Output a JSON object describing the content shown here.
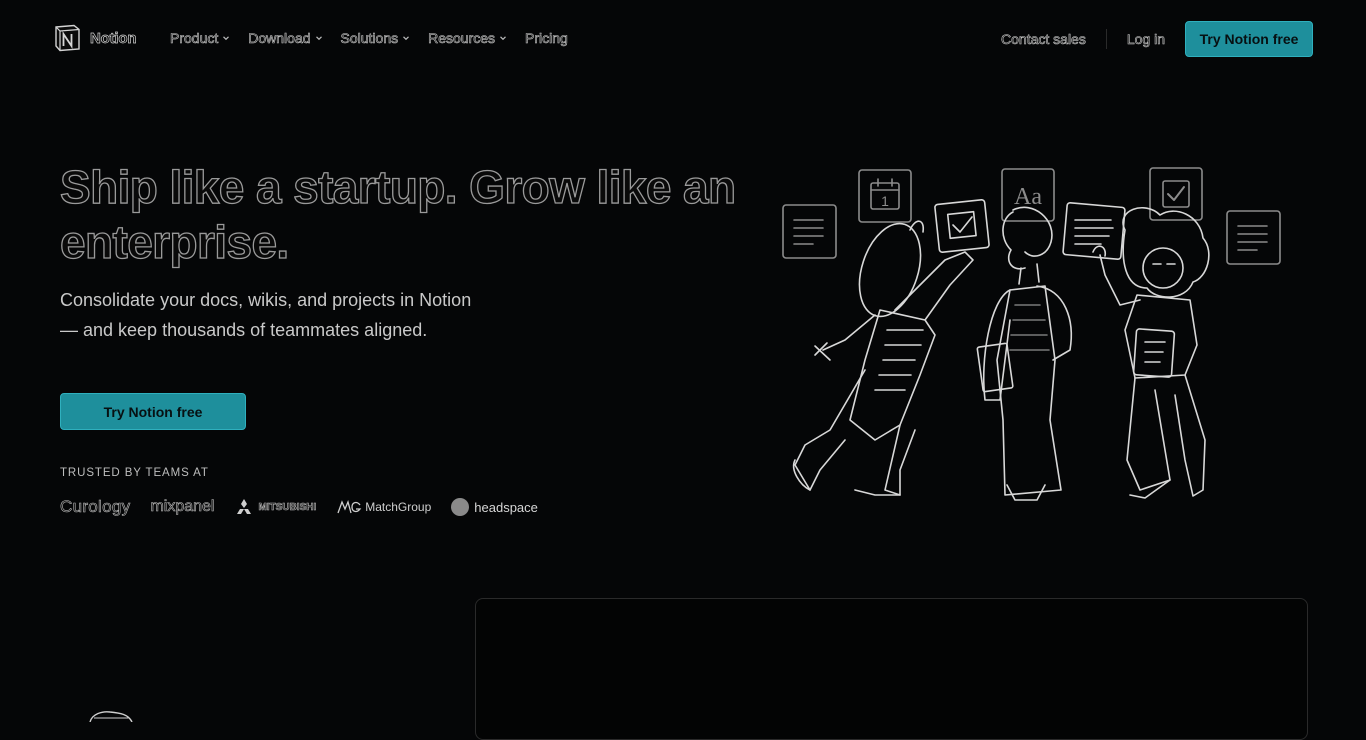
{
  "nav": {
    "logo_text": "Notion",
    "items": [
      {
        "label": "Product",
        "dropdown": true
      },
      {
        "label": "Download",
        "dropdown": true
      },
      {
        "label": "Solutions",
        "dropdown": true
      },
      {
        "label": "Resources",
        "dropdown": true
      },
      {
        "label": "Pricing",
        "dropdown": false
      }
    ],
    "contact_sales": "Contact sales",
    "login": "Log in",
    "cta": "Try Notion free"
  },
  "hero": {
    "title": "Ship like a startup. Grow like an enterprise.",
    "subtitle": "Consolidate your docs, wikis, and projects in Notion — and keep thousands of teammates aligned.",
    "cta": "Try Notion free",
    "trusted_label": "TRUSTED BY TEAMS AT",
    "logos": [
      "Curology",
      "mixpanel",
      "MITSUBISHI",
      "MatchGroup",
      "headspace"
    ],
    "illustration_icons": [
      "document-icon",
      "calendar-icon",
      "text-style-icon",
      "checkbox-icon",
      "document-icon"
    ],
    "calendar_day": "1",
    "text_style_glyph": "Aa"
  },
  "colors": {
    "background": "#050607",
    "accent": "#1e8f9c"
  }
}
